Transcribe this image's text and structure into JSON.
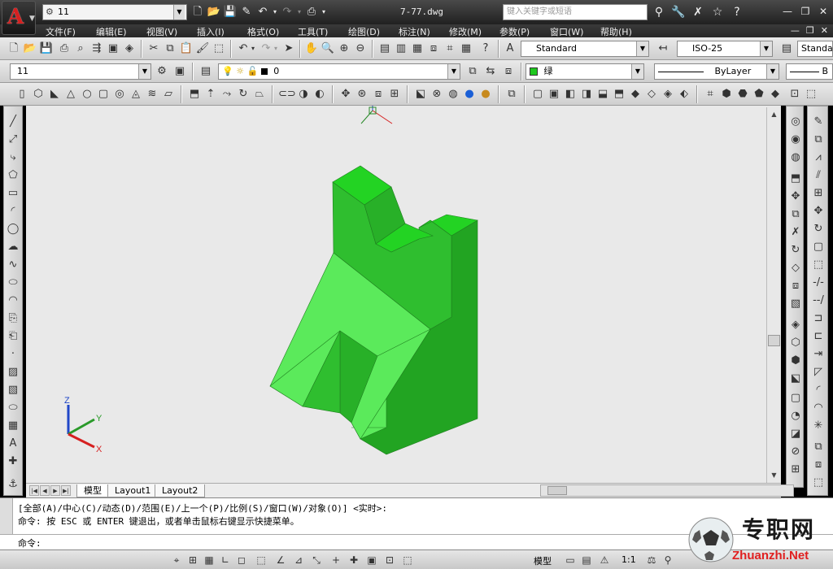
{
  "titlebar": {
    "workspace": "11",
    "document_title": "7-77.dwg",
    "search_placeholder": "键入关键字或短语"
  },
  "menu": {
    "items": [
      "文件(F)",
      "编辑(E)",
      "视图(V)",
      "插入(I)",
      "格式(O)",
      "工具(T)",
      "绘图(D)",
      "标注(N)",
      "修改(M)",
      "参数(P)",
      "窗口(W)",
      "帮助(H)"
    ]
  },
  "styles": {
    "text_style": "Standard",
    "dim_style": "ISO-25",
    "table_style": "Standa"
  },
  "layers": {
    "workspace_combo": "11",
    "current_layer": "0",
    "color": "绿",
    "linetype": "ByLayer",
    "lineweight": "B"
  },
  "tabs": {
    "model": "模型",
    "layout1": "Layout1",
    "layout2": "Layout2"
  },
  "command": {
    "line1": "[全部(A)/中心(C)/动态(D)/范围(E)/上一个(P)/比例(S)/窗口(W)/对象(O)] <实时>:",
    "line2": "命令:  按 ESC 或 ENTER 键退出，或者单击鼠标右键显示快捷菜单。",
    "prompt": "命令:"
  },
  "status": {
    "model": "模型",
    "scale": "1:1"
  },
  "ucs": {
    "x": "X",
    "y": "Y",
    "z": "Z"
  },
  "watermark": {
    "cn": "专职网",
    "en": "Zhuanzhi.Net"
  },
  "colors": {
    "model_light": "#5bea5b",
    "model_mid": "#2fbe2f",
    "model_dark": "#22a422",
    "model_top": "#23d323",
    "drawing_bg": "#e9e9e9"
  }
}
